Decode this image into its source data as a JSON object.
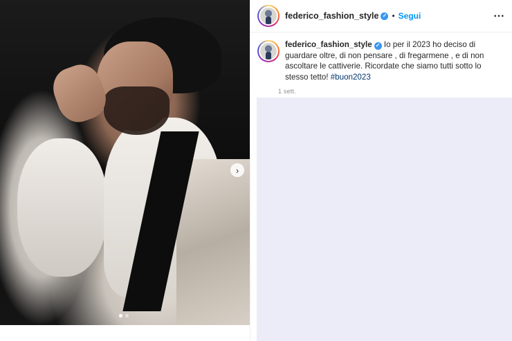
{
  "post": {
    "username": "federico_fashion_style",
    "verified_icon": "verified-badge-icon",
    "separator": "•",
    "follow_label": "Segui",
    "more_label": "⋯",
    "caption": {
      "username": "federico_fashion_style",
      "text": "Io per il 2023 ho deciso di guardare oltre, di non pensare , di fregarmene , e di non ascoltare le cattiverie. Ricordate che siamo tutti sotto lo stesso tetto! ",
      "hashtag": "#buon2023",
      "time": "1 sett."
    },
    "carousel": {
      "next_icon": "›",
      "slide_count": 2,
      "active_slide": 1
    }
  },
  "colors": {
    "accent_blue": "#0095f6",
    "verified_blue": "#3897f0",
    "hashtag": "#00376b",
    "placeholder_bg": "#ecebf8"
  }
}
